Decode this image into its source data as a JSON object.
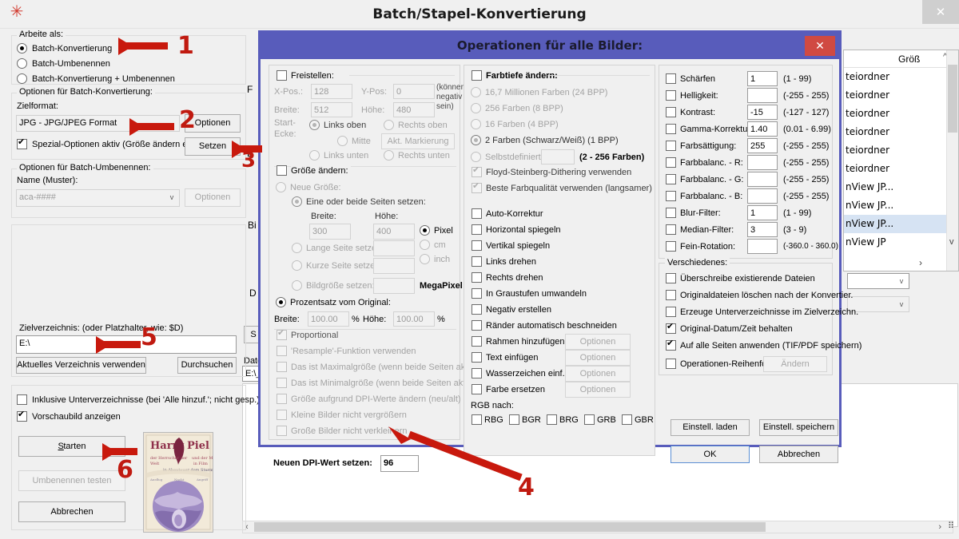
{
  "window": {
    "title": "Batch/Stapel-Konvertierung",
    "close_label": "✕",
    "app_icon": "asterisk-icon"
  },
  "left_panel": {
    "work_as": {
      "title": "Arbeite als:",
      "options": [
        {
          "label": "Batch-Konvertierung",
          "selected": true
        },
        {
          "label": "Batch-Umbenennen",
          "selected": false
        },
        {
          "label": "Batch-Konvertierung + Umbenennen",
          "selected": false
        }
      ]
    },
    "convert_options": {
      "title": "Optionen für Batch-Konvertierung:",
      "target_format_label": "Zielformat:",
      "target_format_value": "JPG - JPG/JPEG Format",
      "options_button": "Optionen",
      "special_options_label": "Spezial-Optionen aktiv (Größe ändern etc.)",
      "special_options_checked": true,
      "set_button": "Setzen"
    },
    "rename_options": {
      "title": "Optionen für Batch-Umbenennen:",
      "name_label": "Name (Muster):",
      "name_value": "aca-####",
      "options_button": "Optionen"
    },
    "target_dir": {
      "title": "Zielverzeichnis: (oder Platzhalter, wie: $D)",
      "value": "E:\\",
      "current_dir_button": "Aktuelles Verzeichnis verwenden",
      "browse_button": "Durchsuchen"
    },
    "misc": {
      "include_subdirs_label": "Inklusive Unterverzeichnisse (bei 'Alle hinzuf.'; nicht gesp.)",
      "include_subdirs_checked": false,
      "show_preview_label": "Vorschaubild anzeigen",
      "show_preview_checked": true
    },
    "actions": {
      "start": "Starten",
      "test_rename": "Umbenennen testen",
      "cancel": "Abbrechen"
    },
    "preview": {
      "title_line1": "Harry",
      "title_line2": "Piel"
    }
  },
  "background_window": {
    "partial_labels": [
      "Bi",
      "D",
      "S",
      "Date"
    ],
    "path_value": "E:\\_",
    "size_column": "Größ",
    "rows": [
      "teiordner",
      "teiordner",
      "teiordner",
      "teiordner",
      "teiordner",
      "teiordner",
      "nView JP...",
      "nView JP...",
      "nView JP...",
      "nView JP"
    ],
    "selected_row_index": 8
  },
  "modal": {
    "title": "Operationen für alle Bilder:",
    "close_label": "✕",
    "crop": {
      "title": "Freistellen:",
      "checked": false,
      "xpos_label": "X-Pos.:",
      "xpos_value": "128",
      "ypos_label": "Y-Pos:",
      "ypos_value": "0",
      "note": "(können negativ sein)",
      "width_label": "Breite:",
      "width_value": "512",
      "height_label": "Höhe:",
      "height_value": "480",
      "corner_label": "Start-Ecke:",
      "corners": [
        {
          "label": "Links oben",
          "selected": true,
          "disabled": false
        },
        {
          "label": "Rechts oben",
          "selected": false,
          "disabled": true
        },
        {
          "label": "Mitte",
          "selected": false,
          "disabled": true
        },
        {
          "label": "Links unten",
          "selected": false,
          "disabled": true
        },
        {
          "label": "Rechts unten",
          "selected": false,
          "disabled": true
        }
      ],
      "mark_button": "Akt. Markierung"
    },
    "resize": {
      "title": "Größe ändern:",
      "checked": false,
      "new_size_label": "Neue Größe:",
      "new_size_selected": false,
      "one_or_both_label": "Eine oder beide Seiten setzen:",
      "one_or_both_selected": true,
      "width_label": "Breite:",
      "width_value": "300",
      "height_label": "Höhe:",
      "height_value": "400",
      "units": [
        {
          "label": "Pixel",
          "selected": true
        },
        {
          "label": "cm",
          "selected": false
        },
        {
          "label": "inch",
          "selected": false
        }
      ],
      "long_side_label": "Lange Seite setzen:",
      "long_side_value": "",
      "short_side_label": "Kurze Seite setzen:",
      "short_side_value": "",
      "image_size_label": "Bildgröße setzen:",
      "image_size_value": "",
      "megapixel_label": "MegaPixel",
      "percent_label": "Prozentsatz vom Original:",
      "percent_selected": true,
      "percent_width_label": "Breite:",
      "percent_width_value": "100.00",
      "percent_height_label": "Höhe:",
      "percent_height_value": "100.00",
      "percent_sign": "%",
      "checkboxes": [
        {
          "label": "Proportional",
          "checked": true
        },
        {
          "label": "'Resample'-Funktion verwenden",
          "checked": false
        },
        {
          "label": "Das ist Maximalgröße (wenn beide Seiten aktiv",
          "checked": false
        },
        {
          "label": "Das ist Minimalgröße (wenn beide Seiten aktiv)",
          "checked": false
        },
        {
          "label": "Größe aufgrund DPI-Werte ändern (neu/alt)",
          "checked": false
        },
        {
          "label": "Kleine Bilder nicht vergrößern",
          "checked": false
        },
        {
          "label": "Große Bilder nicht verkleinern",
          "checked": false
        }
      ],
      "dpi_label": "Neuen DPI-Wert setzen:",
      "dpi_value": "96"
    },
    "colordepth": {
      "title": "Farbtiefe ändern:",
      "checked": false,
      "options": [
        {
          "label": "16,7 Millionen Farben (24 BPP)",
          "selected": false
        },
        {
          "label": "256 Farben (8 BPP)",
          "selected": false
        },
        {
          "label": "16 Farben (4 BPP)",
          "selected": false
        },
        {
          "label": "2 Farben (Schwarz/Weiß) (1 BPP)",
          "selected": true
        },
        {
          "label": "Selbstdefiniert:",
          "selected": false
        }
      ],
      "custom_value": "",
      "custom_range": "(2 - 256 Farben)",
      "dither_label": "Floyd-Steinberg-Dithering verwenden",
      "dither_checked": true,
      "quality_label": "Beste Farbqualität verwenden (langsamer)",
      "quality_checked": true
    },
    "transforms": {
      "items": [
        {
          "label": "Auto-Korrektur",
          "checked": false,
          "button": null
        },
        {
          "label": "Horizontal spiegeln",
          "checked": false,
          "button": null
        },
        {
          "label": "Vertikal spiegeln",
          "checked": false,
          "button": null
        },
        {
          "label": "Links drehen",
          "checked": false,
          "button": null
        },
        {
          "label": "Rechts drehen",
          "checked": false,
          "button": null
        },
        {
          "label": "In Graustufen umwandeln",
          "checked": false,
          "button": null
        },
        {
          "label": "Negativ erstellen",
          "checked": false,
          "button": null
        },
        {
          "label": "Ränder automatisch beschneiden",
          "checked": false,
          "button": null
        },
        {
          "label": "Rahmen hinzufügen",
          "checked": false,
          "button": "Optionen"
        },
        {
          "label": "Text einfügen",
          "checked": false,
          "button": "Optionen"
        },
        {
          "label": "Wasserzeichen einf.",
          "checked": false,
          "button": "Optionen"
        },
        {
          "label": "Farbe ersetzen",
          "checked": false,
          "button": "Optionen"
        }
      ],
      "rgb_label": "RGB nach:",
      "rgb_options": [
        {
          "label": "RBG",
          "checked": false
        },
        {
          "label": "BGR",
          "checked": false
        },
        {
          "label": "BRG",
          "checked": false
        },
        {
          "label": "GRB",
          "checked": false
        },
        {
          "label": "GBR",
          "checked": false
        }
      ]
    },
    "adjustments": [
      {
        "label": "Schärfen",
        "checked": false,
        "value": "1",
        "range": "(1 - 99)"
      },
      {
        "label": "Helligkeit:",
        "checked": false,
        "value": "",
        "range": "(-255 - 255)"
      },
      {
        "label": "Kontrast:",
        "checked": false,
        "value": "-15",
        "range": "(-127 - 127)"
      },
      {
        "label": "Gamma-Korrektur:",
        "checked": false,
        "value": "1.40",
        "range": "(0.01 - 6.99)"
      },
      {
        "label": "Farbsättigung:",
        "checked": false,
        "value": "255",
        "range": "(-255 - 255)"
      },
      {
        "label": "Farbbalanc. - R:",
        "checked": false,
        "value": "",
        "range": "(-255 - 255)"
      },
      {
        "label": "Farbbalanc. - G:",
        "checked": false,
        "value": "",
        "range": "(-255 - 255)"
      },
      {
        "label": "Farbbalanc. - B:",
        "checked": false,
        "value": "",
        "range": "(-255 - 255)"
      },
      {
        "label": "Blur-Filter:",
        "checked": false,
        "value": "1",
        "range": "(1 - 99)"
      },
      {
        "label": "Median-Filter:",
        "checked": false,
        "value": "3",
        "range": "(3 - 9)"
      },
      {
        "label": "Fein-Rotation:",
        "checked": false,
        "value": "",
        "range": "(-360.0 - 360.0)"
      }
    ],
    "misc": {
      "title": "Verschiedenes:",
      "items": [
        {
          "label": "Überschreibe existierende Dateien",
          "checked": false
        },
        {
          "label": "Originaldateien löschen nach der Konvertier.",
          "checked": false
        },
        {
          "label": "Erzeuge Unterverzeichnisse im Zielverzeichn.",
          "checked": false
        },
        {
          "label": "Original-Datum/Zeit behalten",
          "checked": true
        },
        {
          "label": "Auf alle Seiten anwenden (TIF/PDF speichern)",
          "checked": true
        }
      ],
      "order_label": "Operationen-Reihenfolge",
      "order_checked": false,
      "order_button": "Ändern"
    },
    "buttons": {
      "load_settings": "Einstell. laden",
      "save_settings": "Einstell. speichern",
      "ok": "OK",
      "cancel": "Abbrechen"
    }
  },
  "annotations": {
    "accent_color": "#c8190d",
    "markers": [
      "1",
      "2",
      "3",
      "4",
      "5",
      "6"
    ]
  }
}
